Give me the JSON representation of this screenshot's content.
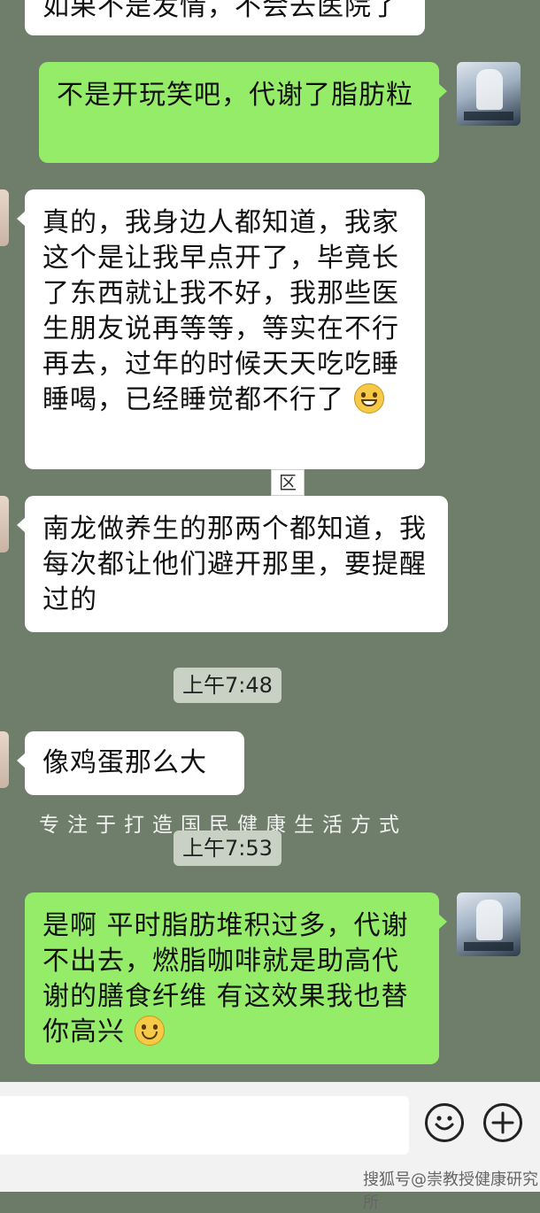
{
  "messages": {
    "top_partial": "如果不是发情，不会去医院了",
    "m1": "不是开玩笑吧，代谢了脂肪粒",
    "m2": "真的，我身边人都知道，我家这个是让我早点开了，毕竟长了东西就让我不好，我那些医生朋友说再等等，等实在不行再去，过年的时候天天吃吃睡睡喝，已经睡觉都不行了",
    "m3": "南龙做养生的那两个都知道，我每次都让他们避开那里，要提醒过的",
    "m4": "像鸡蛋那么大",
    "m5": "是啊 平时脂肪堆积过多，代谢不出去，燃脂咖啡就是助高代谢的膳食纤维 有这效果我也替你高兴"
  },
  "times": {
    "t1": "上午7:48",
    "t2": "上午7:53"
  },
  "icons": {
    "mini": "区",
    "grin": "grinning-emoji",
    "smile": "smiling-emoji",
    "emoji_button": "emoji-face-icon",
    "plus_button": "plus-icon"
  },
  "watermark": {
    "slogan": "专注于打造国民健康生活方式",
    "footer": "搜狐号@崇教授健康研究所"
  }
}
